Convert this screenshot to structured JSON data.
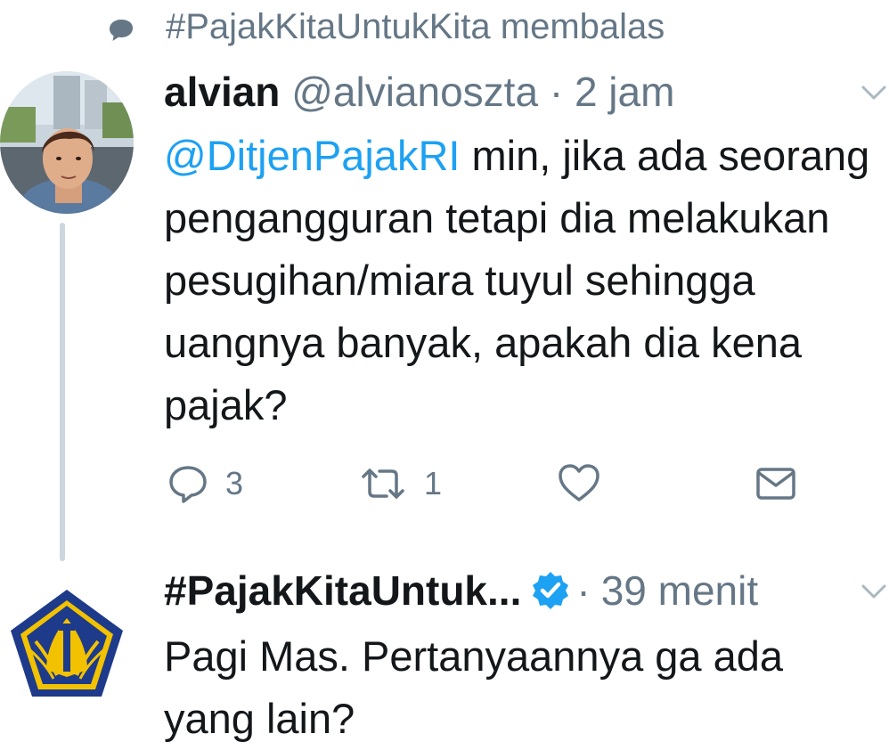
{
  "reply_context": {
    "icon": "speech-bubble-icon",
    "text": "#PajakKitaUntukKita membalas"
  },
  "tweet1": {
    "display_name": "alvian",
    "handle": "@alvianoszta",
    "separator": "·",
    "time": "2 jam",
    "mention": "@DitjenPajakRI",
    "text": " min, jika ada seorang pengangguran tetapi dia melakukan pesugihan/miara tuyul sehingga uangnya banyak, apakah dia kena pajak?",
    "actions": {
      "reply_count": "3",
      "retweet_count": "1"
    }
  },
  "tweet2": {
    "display_name": "#PajakKitaUntuk...",
    "separator": "·",
    "time": "39 menit",
    "text": "Pagi Mas. Pertanyaannya ga ada yang lain?"
  },
  "colors": {
    "link": "#1da1f2",
    "muted": "#657786",
    "thread_line": "#ccd6dd",
    "text": "#14171a"
  }
}
